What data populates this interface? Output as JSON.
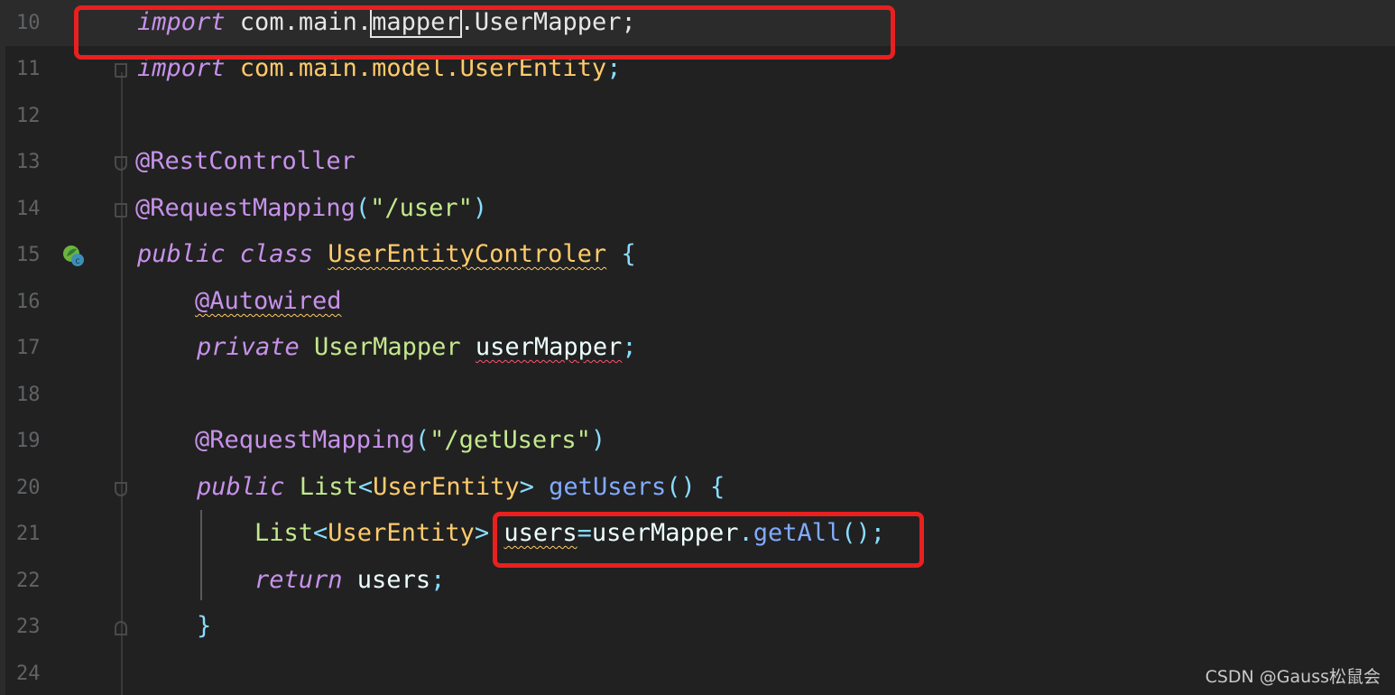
{
  "editor": {
    "lines": [
      {
        "num": "10",
        "tokens": [
          [
            "kw",
            "import"
          ],
          [
            "pkg",
            " com.main."
          ],
          [
            "pkg",
            "mapper"
          ],
          [
            "pkg",
            ".UserMapper;"
          ]
        ]
      },
      {
        "num": "11",
        "tokens": [
          [
            "kw",
            "import"
          ],
          [
            "cls",
            " com.main.model.UserEntity"
          ],
          [
            "punc",
            ";"
          ]
        ]
      },
      {
        "num": "12",
        "tokens": []
      },
      {
        "num": "13",
        "tokens": [
          [
            "ann",
            "@RestController"
          ]
        ]
      },
      {
        "num": "14",
        "tokens": [
          [
            "ann",
            "@RequestMapping"
          ],
          [
            "punc",
            "("
          ],
          [
            "str",
            "\"/user\""
          ],
          [
            "punc",
            ")"
          ]
        ]
      },
      {
        "num": "15",
        "tokens": [
          [
            "kw",
            "public class "
          ],
          [
            "cls",
            "UserEntityControler"
          ],
          [
            "punc",
            " {"
          ]
        ]
      },
      {
        "num": "16",
        "tokens": [
          [
            "ann",
            "@Autowired"
          ]
        ]
      },
      {
        "num": "17",
        "tokens": [
          [
            "kw",
            "private "
          ],
          [
            "typ",
            "UserMapper "
          ],
          [
            "field",
            "userMapper"
          ],
          [
            "punc",
            ";"
          ]
        ]
      },
      {
        "num": "18",
        "tokens": []
      },
      {
        "num": "19",
        "tokens": [
          [
            "ann",
            "@RequestMapping"
          ],
          [
            "punc",
            "("
          ],
          [
            "str",
            "\"/getUsers\""
          ],
          [
            "punc",
            ")"
          ]
        ]
      },
      {
        "num": "20",
        "tokens": [
          [
            "kw",
            "public "
          ],
          [
            "typ",
            "List"
          ],
          [
            "punc",
            "<"
          ],
          [
            "cls",
            "UserEntity"
          ],
          [
            "punc",
            "> "
          ],
          [
            "fn",
            "getUsers"
          ],
          [
            "punc",
            "() {"
          ]
        ]
      },
      {
        "num": "21",
        "tokens": [
          [
            "typ",
            "List"
          ],
          [
            "punc",
            "<"
          ],
          [
            "cls",
            "UserEntity"
          ],
          [
            "punc",
            "> "
          ],
          [
            "field",
            "users"
          ],
          [
            "punc",
            "="
          ],
          [
            "field",
            "userMapper"
          ],
          [
            "punc",
            "."
          ],
          [
            "fn",
            "getAll"
          ],
          [
            "punc",
            "();"
          ]
        ]
      },
      {
        "num": "22",
        "tokens": [
          [
            "kw",
            "return "
          ],
          [
            "field",
            "users"
          ],
          [
            "punc",
            ";"
          ]
        ]
      },
      {
        "num": "23",
        "tokens": [
          [
            "punc",
            "}"
          ]
        ]
      },
      {
        "num": "24",
        "tokens": []
      }
    ]
  },
  "icons": {
    "gutter_icon": "spring-bean-class-icon"
  },
  "colors": {
    "highlight_box": "#e8201f",
    "background": "#212121"
  },
  "watermark": "CSDN @Gauss松鼠会"
}
